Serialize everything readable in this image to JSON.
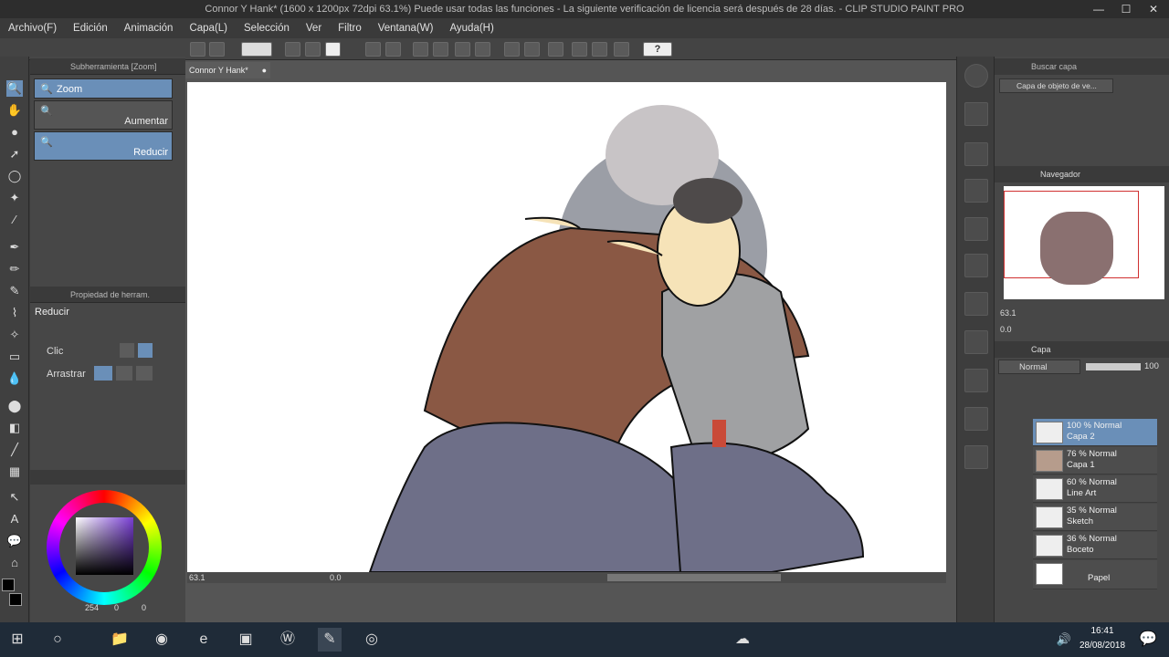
{
  "title": "Connor Y Hank* (1600 x 1200px 72dpi 63.1%)  Puede usar todas las funciones - La siguiente verificación de licencia será después de 28 días. - CLIP STUDIO PAINT PRO",
  "menu": [
    "Archivo(F)",
    "Edición",
    "Animación",
    "Capa(L)",
    "Selección",
    "Ver",
    "Filtro",
    "Ventana(W)",
    "Ayuda(H)"
  ],
  "subtool": {
    "header": "Subherramienta [Zoom]",
    "items": [
      "Zoom",
      "Aumentar",
      "Reducir"
    ]
  },
  "toolprop": {
    "header": "Propiedad de herram.",
    "title": "Reducir",
    "click_label": "Clic",
    "drag_label": "Arrastrar"
  },
  "color": {
    "values": [
      "254",
      "0",
      "0"
    ]
  },
  "document_tab": "Connor Y Hank*",
  "status": {
    "zoom": "63.1",
    "angle": "0.0"
  },
  "search_layer": {
    "header": "Buscar capa",
    "field": "Capa de objeto de ve..."
  },
  "navigator": {
    "header": "Navegador",
    "zoom": "63.1",
    "angle": "0.0"
  },
  "layers_panel": {
    "header": "Capa",
    "blend": "Normal",
    "opacity": "100"
  },
  "layers": [
    {
      "mode": "100 % Normal",
      "name": "Capa 2"
    },
    {
      "mode": "76 % Normal",
      "name": "Capa 1"
    },
    {
      "mode": "60 % Normal",
      "name": "Line Art"
    },
    {
      "mode": "35 % Normal",
      "name": "Sketch"
    },
    {
      "mode": "36 % Normal",
      "name": "Boceto"
    },
    {
      "mode": "",
      "name": "Papel"
    }
  ],
  "taskbar": {
    "time": "16:41",
    "date": "28/08/2018"
  },
  "accent": "#6a8fb8"
}
